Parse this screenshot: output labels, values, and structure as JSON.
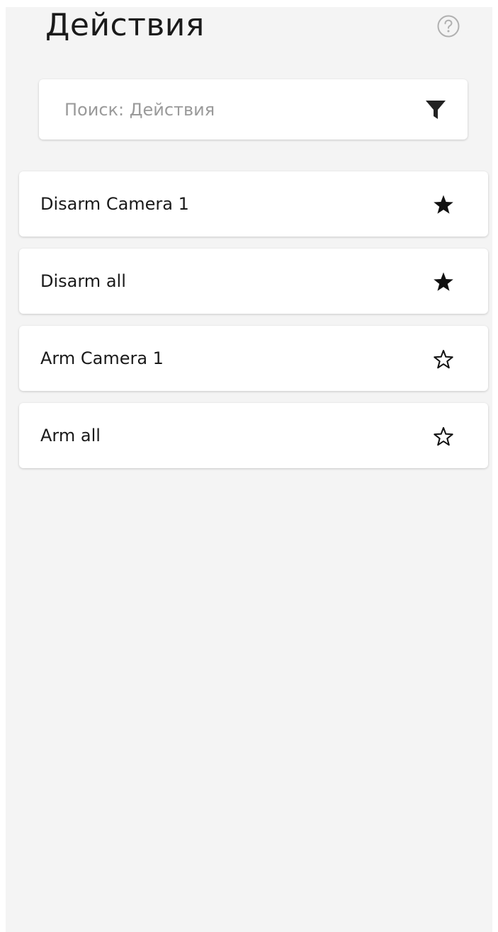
{
  "header": {
    "title": "Действия",
    "help_icon": "help-circle-icon"
  },
  "search": {
    "placeholder": "Поиск: Действия",
    "value": "",
    "filter_icon": "filter-icon"
  },
  "actions": [
    {
      "label": "Disarm Camera 1",
      "favorite": true
    },
    {
      "label": "Disarm all",
      "favorite": true
    },
    {
      "label": "Arm Camera 1",
      "favorite": false
    },
    {
      "label": "Arm all",
      "favorite": false
    }
  ],
  "colors": {
    "background": "#f4f4f4",
    "card": "#ffffff",
    "text": "#1a1a1a",
    "placeholder": "#9a9a9a",
    "icon": "#222222",
    "help_icon": "#b0b0b0"
  }
}
